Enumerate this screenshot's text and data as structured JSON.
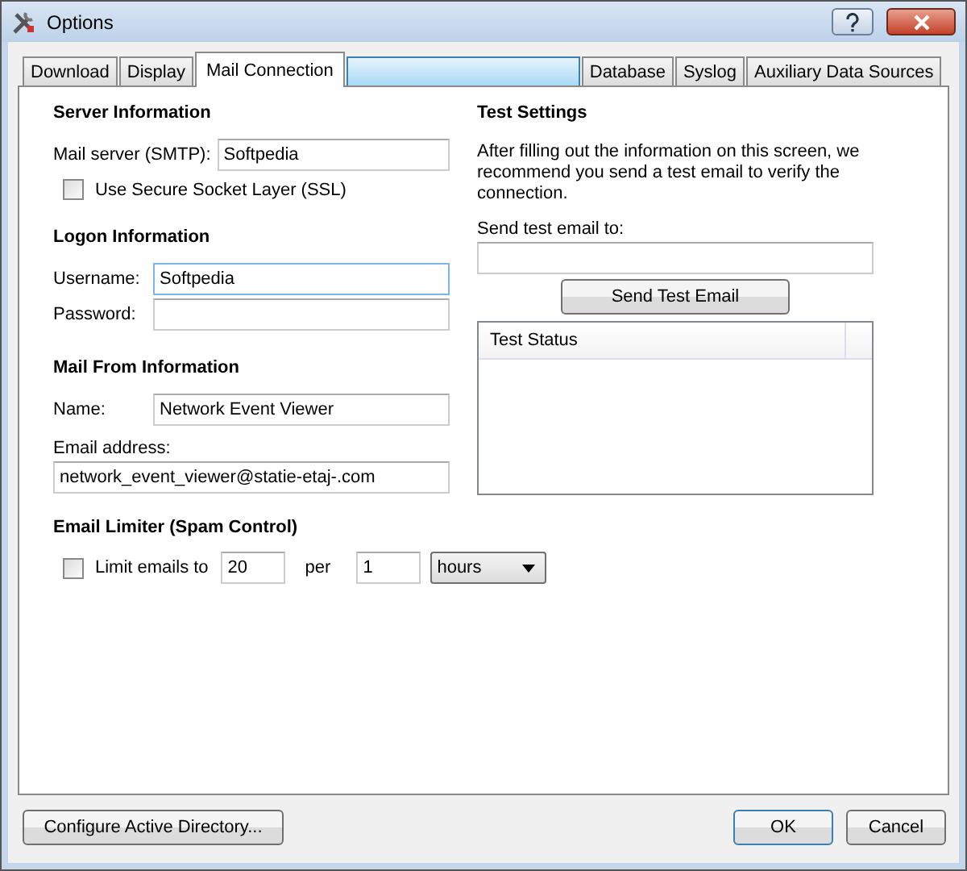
{
  "window": {
    "title": "Options"
  },
  "tabs": [
    {
      "kind": "tab",
      "label": "Download",
      "selected": false
    },
    {
      "kind": "tab",
      "label": "Display",
      "selected": false
    },
    {
      "kind": "tab",
      "label": "Mail Connection",
      "selected": true
    },
    {
      "kind": "blank",
      "selected": false
    },
    {
      "kind": "tab",
      "label": "Database",
      "selected": false
    },
    {
      "kind": "tab",
      "label": "Syslog",
      "selected": false
    },
    {
      "kind": "tab",
      "label": "Auxiliary Data Sources",
      "selected": false
    }
  ],
  "server": {
    "heading": "Server Information",
    "smtp_label": "Mail server (SMTP):",
    "smtp_value": "Softpedia",
    "ssl": {
      "label": "Use Secure Socket Layer (SSL)",
      "checked": false
    }
  },
  "logon": {
    "heading": "Logon Information",
    "username_label": "Username:",
    "username_value": "Softpedia",
    "password_label": "Password:"
  },
  "mail_from": {
    "heading": "Mail From Information",
    "name_label": "Name:",
    "name_value": "Network Event Viewer",
    "email_label": "Email address:",
    "email_value": "network_event_viewer@statie-etaj-.com"
  },
  "test": {
    "heading": "Test Settings",
    "description": "After filling out the information on this screen, we recommend you send a test email to verify the connection.",
    "send_to_label": "Send test email to:",
    "send_button": "Send Test Email",
    "status_column": "Test Status"
  },
  "limiter": {
    "heading": "Email Limiter (Spam Control)",
    "checkbox": {
      "label": "Limit emails to",
      "checked": false
    },
    "count": "20",
    "per_label": "per",
    "period": "1",
    "unit": "hours"
  },
  "buttons": {
    "configure": "Configure Active Directory...",
    "ok": "OK",
    "cancel": "Cancel"
  }
}
